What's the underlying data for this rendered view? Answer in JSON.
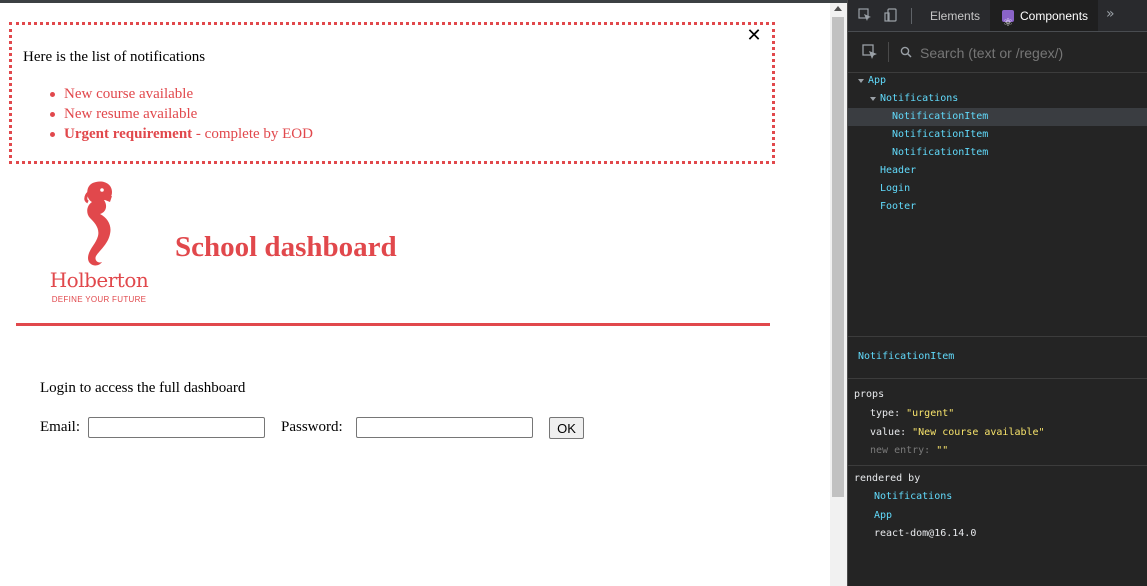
{
  "notifications": {
    "close_glyph": "✕",
    "title": "Here is the list of notifications",
    "items": [
      {
        "text": "New course available"
      },
      {
        "text": "New resume available"
      },
      {
        "strong": "Urgent requirement",
        "rest": " - complete by EOD"
      }
    ]
  },
  "header": {
    "logo_text": "Holberton",
    "logo_tagline": "DEFINE YOUR FUTURE",
    "title": "School dashboard"
  },
  "login": {
    "intro": "Login to access the full dashboard",
    "email_label": "Email:",
    "email_value": "",
    "password_label": "Password:",
    "password_value": "",
    "ok_label": "OK"
  },
  "devtools": {
    "tabs": [
      {
        "label": "Elements",
        "active": false
      },
      {
        "label": "Components",
        "active": true
      }
    ],
    "more_glyph": "»",
    "search_placeholder": "Search (text or /regex/)",
    "tree": [
      {
        "label": "App",
        "expanded": true,
        "selected": false
      },
      {
        "label": "Notifications",
        "expanded": true,
        "selected": false
      },
      {
        "label": "NotificationItem",
        "selected": true
      },
      {
        "label": "NotificationItem",
        "selected": false
      },
      {
        "label": "NotificationItem",
        "selected": false
      },
      {
        "label": "Header",
        "selected": false
      },
      {
        "label": "Login",
        "selected": false
      },
      {
        "label": "Footer",
        "selected": false
      }
    ],
    "selected_component": "NotificationItem",
    "props_heading": "props",
    "props": [
      {
        "key": "type:",
        "value": "\"urgent\"",
        "muted": false
      },
      {
        "key": "value:",
        "value": "\"New course available\"",
        "muted": false
      },
      {
        "key": "new entry:",
        "value": "\"\"",
        "muted": true
      }
    ],
    "rendered_by_heading": "rendered by",
    "rendered_by": [
      {
        "label": "Notifications",
        "is_component": true
      },
      {
        "label": "App",
        "is_component": true
      },
      {
        "label": "react-dom@16.14.0",
        "is_component": false
      }
    ]
  },
  "colors": {
    "brand_red": "#e1484c",
    "devtools_bg": "#242424",
    "component_cyan": "#61dafb",
    "prop_value_yellow": "#f7e36b"
  }
}
